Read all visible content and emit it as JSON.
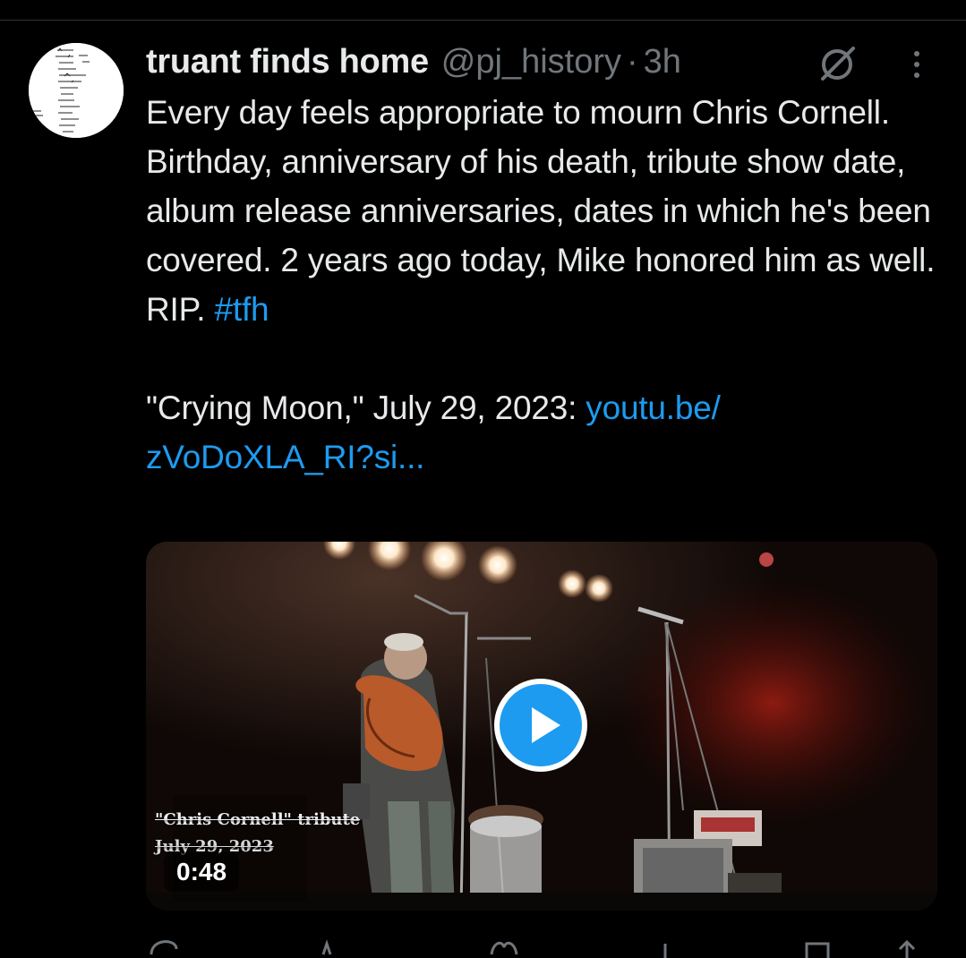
{
  "tweet": {
    "display_name": "truant finds home",
    "handle": "@pj_history",
    "separator": "·",
    "time": "3h",
    "text_line1": "Every day feels appropriate to mourn Chris Cornell. Birthday, anniversary of his death, tribute show date, album release anniversaries, dates in which he's been covered. 2 years ago today, Mike honored him as well. RIP.",
    "hashtag": "#tfh",
    "text_line2": "\"Crying Moon,\" July 29, 2023:",
    "link": "youtu.be/ zVoDoXLA_RI?si..."
  },
  "media": {
    "overlay_caption_line1": "\"Chris Cornell\" tribute",
    "overlay_caption_line2": "July 29, 2023",
    "duration": "0:48"
  },
  "icons": {
    "avatar": "handwritten-setlist-avatar",
    "grok": "grok-icon",
    "more": "more-vertical-icon",
    "play": "play-icon"
  },
  "colors": {
    "background": "#000000",
    "text": "#e7e9ea",
    "secondary": "#71767b",
    "accent": "#1d9bf0"
  }
}
